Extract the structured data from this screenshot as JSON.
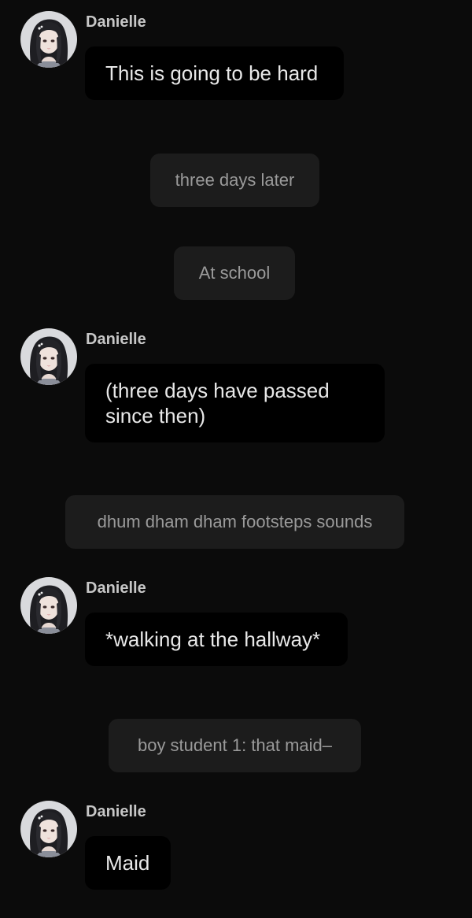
{
  "messages": [
    {
      "sender": "Danielle",
      "text": "This is going to be hard"
    },
    {
      "narration": "three days later"
    },
    {
      "narration": "At school"
    },
    {
      "sender": "Danielle",
      "text": "(three days have passed since then)"
    },
    {
      "narration": "dhum dham dham footsteps sounds"
    },
    {
      "sender": "Danielle",
      "text": "*walking at the hallway*"
    },
    {
      "narration": "boy student 1: that maid–"
    },
    {
      "sender": "Danielle",
      "text": "Maid"
    }
  ],
  "avatar_icon": "character-avatar-icon",
  "colors": {
    "background": "#0b0b0b",
    "character_bubble": "#000000",
    "narration_bubble": "#1c1c1c",
    "sender_text": "#c7c7c7",
    "message_text": "#e8e8e8",
    "narration_text": "#9a9a9a"
  }
}
